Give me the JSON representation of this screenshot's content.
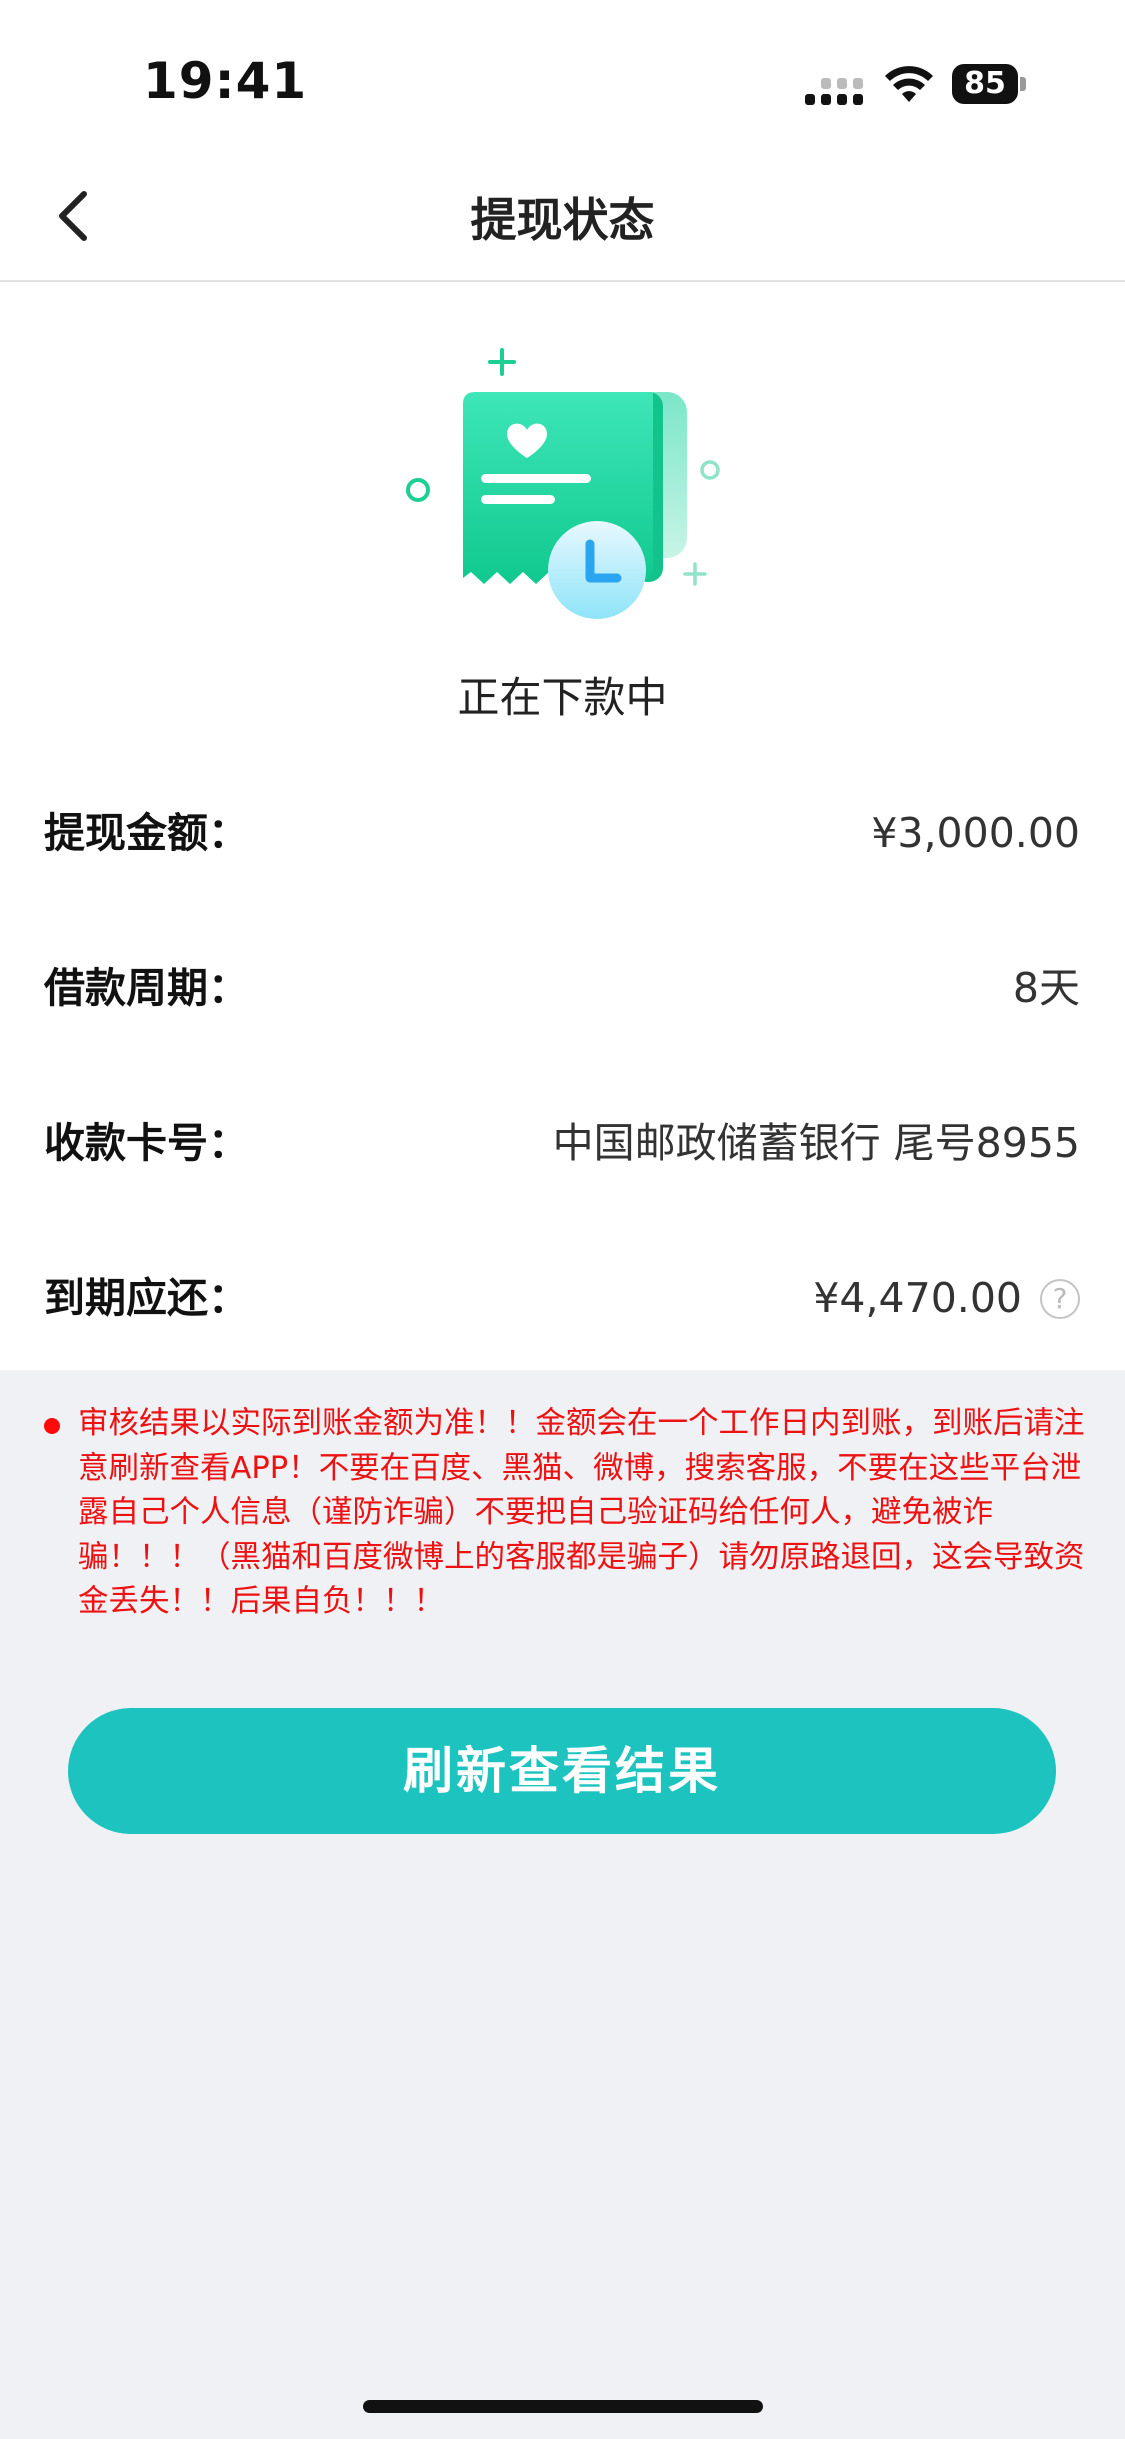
{
  "status_bar": {
    "time": "19:41",
    "battery_level": "85"
  },
  "header": {
    "title": "提现状态",
    "back_icon": "chevron-left-icon"
  },
  "status": {
    "illustration_icon": "receipt-clock-icon",
    "text": "正在下款中"
  },
  "details": [
    {
      "label": "提现金额：",
      "value": "¥3,000.00"
    },
    {
      "label": "借款周期：",
      "value": "8天"
    },
    {
      "label": "收款卡号：",
      "value": "中国邮政储蓄银行 尾号8955"
    },
    {
      "label": "到期应还：",
      "value": "¥4,470.00",
      "help_icon": "?"
    }
  ],
  "notice": {
    "text": "审核结果以实际到账金额为准！！金额会在一个工作日内到账，到账后请注意刷新查看APP！不要在百度、黑猫、微博，搜索客服，不要在这些平台泄露自己个人信息（谨防诈骗）不要把自己验证码给任何人，避免被诈骗！！！（黑猫和百度微博上的客服都是骗子）请勿原路退回，这会导致资金丢失！！后果自负！！！",
    "color": "#ee1111"
  },
  "button": {
    "label": "刷新查看结果",
    "color": "#1dc3bf"
  }
}
